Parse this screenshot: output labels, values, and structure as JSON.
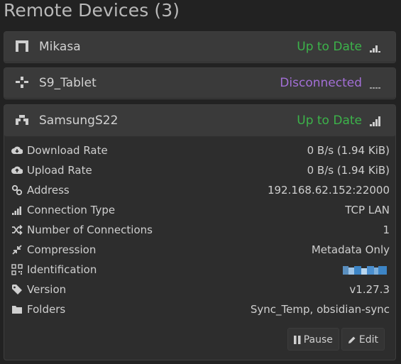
{
  "section": {
    "title": "Remote Devices (3)"
  },
  "devices": [
    {
      "name": "Mikasa",
      "status": "Up to Date",
      "status_kind": "ok",
      "icon": "desktop-icon",
      "signal": "signal-partial-icon"
    },
    {
      "name": "S9_Tablet",
      "status": "Disconnected",
      "status_kind": "disconnected",
      "icon": "disconnected-icon",
      "signal": "signal-none-icon"
    },
    {
      "name": "SamsungS22",
      "status": "Up to Date",
      "status_kind": "ok",
      "icon": "phone-icon",
      "signal": "signal-full-icon",
      "details": {
        "download_rate_label": "Download Rate",
        "download_rate_value": "0 B/s (1.94 KiB)",
        "upload_rate_label": "Upload Rate",
        "upload_rate_value": "0 B/s (1.94 KiB)",
        "address_label": "Address",
        "address_value": "192.168.62.152:22000",
        "connection_type_label": "Connection Type",
        "connection_type_value": "TCP LAN",
        "connections_label": "Number of Connections",
        "connections_value": "1",
        "compression_label": "Compression",
        "compression_value": "Metadata Only",
        "identification_label": "Identification",
        "version_label": "Version",
        "version_value": "v1.27.3",
        "folders_label": "Folders",
        "folders_value": "Sync_Temp, obsidian-sync"
      },
      "actions": {
        "pause_label": "Pause",
        "edit_label": "Edit"
      }
    }
  ],
  "colors": {
    "status_ok": "#3cb34a",
    "status_disconnected": "#a36fd6",
    "identification_blur": "#3d85c6"
  }
}
